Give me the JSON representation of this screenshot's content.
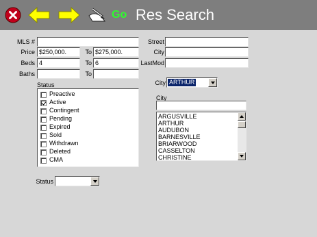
{
  "toolbar": {
    "go_label": "Go",
    "title": "Res Search",
    "icons": [
      "close-icon",
      "back-arrow-icon",
      "forward-arrow-icon",
      "edit-pen-icon"
    ],
    "colors": {
      "bar": "#7e7e7e",
      "go": "#2cff2c",
      "arrow": "#ffff00",
      "close": "#c0001a"
    }
  },
  "form": {
    "mls_label": "MLS #",
    "mls_value": "",
    "price_label": "Price",
    "price_from": "$250,000.",
    "price_to_label": "To",
    "price_to": "$275,000.",
    "beds_label": "Beds",
    "beds_from": "4",
    "beds_to_label": "To",
    "beds_to": "6",
    "baths_label": "Baths",
    "baths_from": "",
    "baths_to_label": "To",
    "baths_to": "",
    "street_label": "Street",
    "street_value": "",
    "city_label": "City",
    "city_value": "",
    "lastmod_label": "LastMod",
    "lastmod_value": ""
  },
  "status": {
    "label": "Status",
    "items": [
      {
        "label": "Preactive",
        "checked": false
      },
      {
        "label": "Active",
        "checked": true
      },
      {
        "label": "Contingent",
        "checked": false
      },
      {
        "label": "Pending",
        "checked": false
      },
      {
        "label": "Expired",
        "checked": false
      },
      {
        "label": "Sold",
        "checked": false
      },
      {
        "label": "Withdrawn",
        "checked": false
      },
      {
        "label": "Deleted",
        "checked": false
      },
      {
        "label": "CMA",
        "checked": false
      }
    ],
    "dropdown_label": "Status",
    "dropdown_value": ""
  },
  "city_select": {
    "label": "City",
    "value": "ARTHUR"
  },
  "city_list": {
    "label": "City",
    "filter_value": "",
    "items": [
      "ARGUSVILLE",
      "ARTHUR",
      "AUDUBON",
      "BARNESVILLE",
      "BRIARWOOD",
      "CASSELTON",
      "CHRISTINE"
    ]
  }
}
